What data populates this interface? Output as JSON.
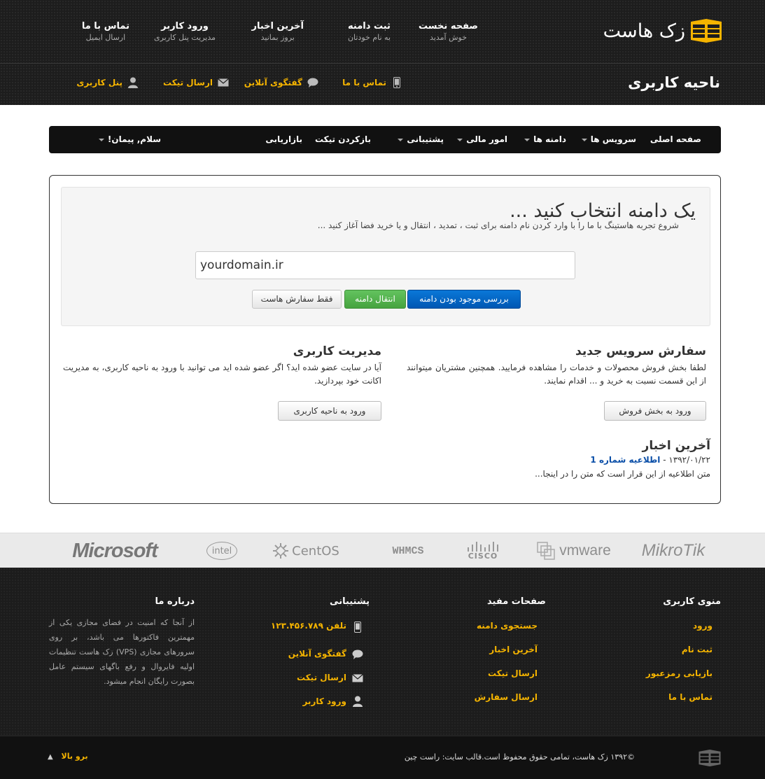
{
  "brand": {
    "name": "زک هاست"
  },
  "top_nav": [
    {
      "title": "صفحه نخست",
      "sub": "خوش آمدید"
    },
    {
      "title": "ثبت دامنه",
      "sub": "به نام خودتان"
    },
    {
      "title": "آخرین اخبار",
      "sub": "بروز بمانید"
    },
    {
      "title": "ورود کاربر",
      "sub": "مدیریت پنل کاربری"
    },
    {
      "title": "تماس با ما",
      "sub": "ارسال ایمیل"
    }
  ],
  "page_title": "ناحیه کاربری",
  "quick_links": [
    "تماس با ما",
    "گفتگوی آنلاین",
    "ارسال تیکت",
    "پنل کاربری"
  ],
  "main_nav": {
    "items": [
      "صفحه اصلی",
      "سرویس ها",
      "دامنه ها",
      "امور مالی",
      "پشتیبانی",
      "بازکردن تیکت",
      "بازاریابی"
    ],
    "greeting": "سلام, پیمان!"
  },
  "hero": {
    "title": "یک دامنه انتخاب کنید ...",
    "subtitle": "شروع تجربه هاستینگ با ما را با وارد کردن نام دامنه برای ثبت ، تمدید ، انتقال و یا خرید فضا آغاز کنید ...",
    "domain_value": "yourdomain.ir",
    "btn_check": "بررسی موجود بودن دامنه",
    "btn_transfer": "انتقال دامنه",
    "btn_hosting": "فقط سفارش هاست"
  },
  "order_section": {
    "title": "سفارش سرویس جدید",
    "text": "لطفا بخش فروش محصولات و خدمات را مشاهده فرمایید. همچنین مشتریان میتوانند از این قسمت نسبت به خرید و ... اقدام نمایند.",
    "button": "ورود به بخش فروش"
  },
  "account_section": {
    "title": "مدیریت کاربری",
    "text": "آیا در سایت عضو شده اید؟ اگر عضو شده اید می توانید با ورود به ناحیه کاربری، به مدیریت اکانت خود بپردازید.",
    "button": "ورود به ناحیه کاربری"
  },
  "news": {
    "title": "آخرین اخبار",
    "date": "۱۳۹۲/۰۱/۲۲ - ",
    "link": "اطلاعیه شماره 1",
    "text": "متن اطلاعیه از این قرار است که متن را در اینجا..."
  },
  "partners": [
    "MikroTik",
    "vmware",
    "CISCO",
    "WHMCS",
    "CentOS",
    "intel",
    "Microsoft"
  ],
  "footer": {
    "user_menu": {
      "title": "منوی کاربری",
      "links": [
        "ورود",
        "ثبت نام",
        "بازیابی رمزعبور",
        "تماس با ما"
      ]
    },
    "useful_pages": {
      "title": "صفحات مفید",
      "links": [
        "جستجوی دامنه",
        "آخرین اخبار",
        "ارسال تیکت",
        "ارسال سفارش"
      ]
    },
    "support": {
      "title": "پشتیبانی",
      "links": [
        "تلفن ۱۲۳.۴۵۶.۷۸۹",
        "گفتگوی آنلاین",
        "ارسال تیکت",
        "ورود کاربر"
      ]
    },
    "about": {
      "title": "درباره ما",
      "text": "از آنجا که امنیت در فضای مجازی یکی از مهمترین فاکتورها می باشد، بر روی سرورهای مجازی (VPS) زک هاست تنظیمات اولیه فایروال و رفع باگهای سیستم عامل بصورت رایگان انجام میشود."
    }
  },
  "bottom": {
    "copyright": "©۱۳۹۲ زک هاست، تمامی حقوق محفوظ است.قالب سایت: راست چین",
    "to_top": "برو بالا"
  },
  "colors": {
    "accent": "#f5b400",
    "primary_button": "#0a6fd0",
    "success_button": "#52b34c",
    "header_bg": "#1d1d1d"
  }
}
